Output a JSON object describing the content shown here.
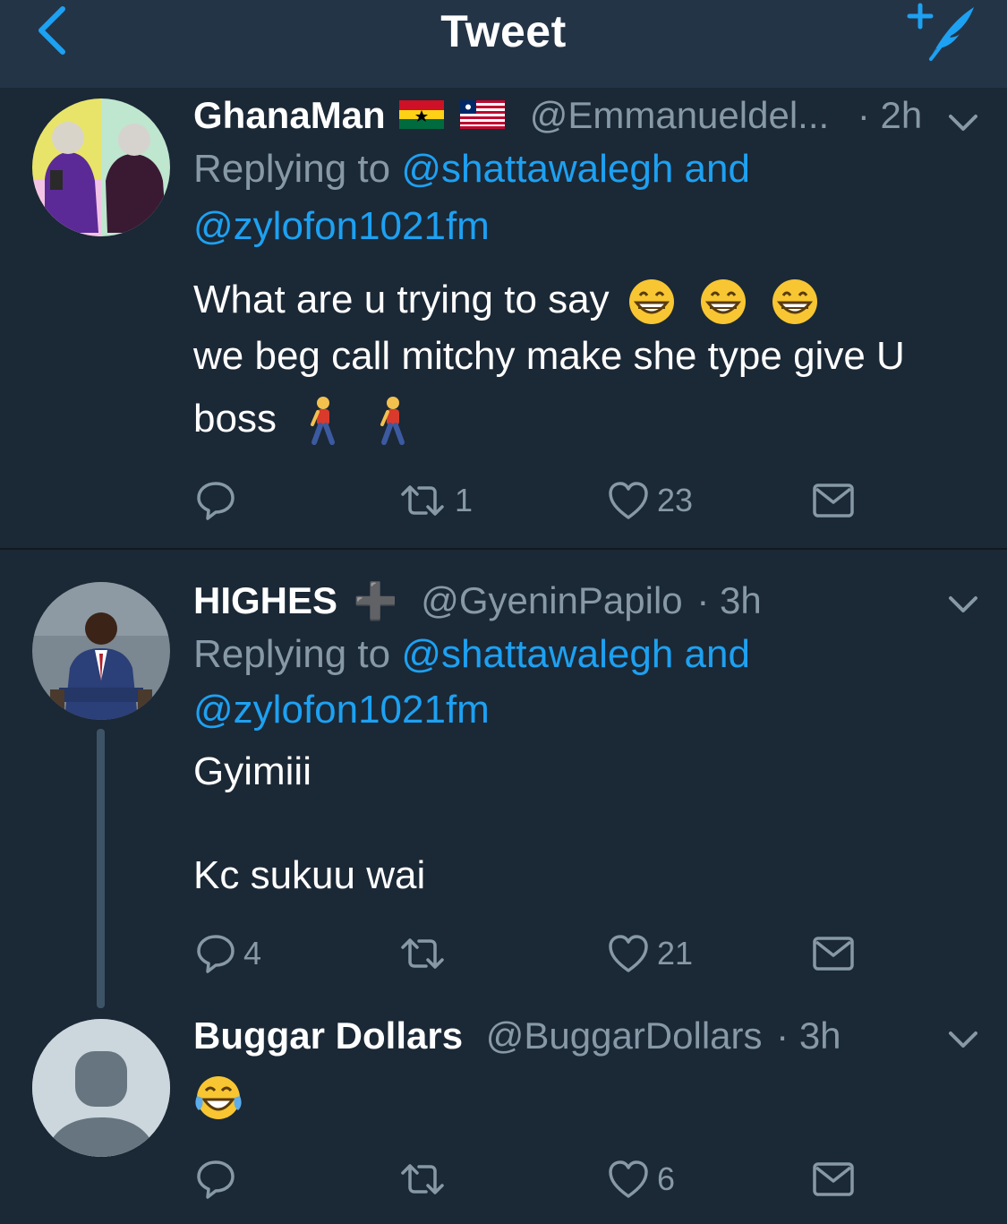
{
  "header": {
    "title": "Tweet",
    "back_icon": "chevron-left-icon",
    "compose_icon": "compose-feather-icon"
  },
  "colors": {
    "background": "#1b2836",
    "topbar": "#243447",
    "accent": "#1da1f2",
    "muted": "#8899a6"
  },
  "tweets": [
    {
      "name": "GhanaMan",
      "flags": [
        "ghana-flag",
        "liberia-flag"
      ],
      "handle": "@Emmanueldel...",
      "time": "· 2h",
      "replying_prefix": "Replying to ",
      "reply_mention_1": "@shattawalegh and",
      "reply_mention_2": "@zylofon1021fm",
      "line1": "What are u trying to say",
      "line2": "we beg call mitchy make she type give U",
      "line3": "boss",
      "emoji_line1": "grinning-face-emoji",
      "emoji_line3": "person-walking-emoji",
      "reply_count": "",
      "retweet_count": "1",
      "like_count": "23"
    },
    {
      "name": "HIGHES",
      "badge": "➕",
      "handle": "@GyeninPapilo",
      "time": "· 3h",
      "replying_prefix": "Replying to ",
      "reply_mention_1": "@shattawalegh and",
      "reply_mention_2": "@zylofon1021fm",
      "line1": "Gyimiii",
      "line2": "Kc sukuu wai",
      "reply_count": "4",
      "retweet_count": "",
      "like_count": "21"
    },
    {
      "name": "Buggar Dollars",
      "handle": "@BuggarDollars",
      "time": "· 3h",
      "emoji": "face-with-tears-of-joy-emoji",
      "reply_count": "",
      "retweet_count": "",
      "like_count": "6"
    }
  ]
}
